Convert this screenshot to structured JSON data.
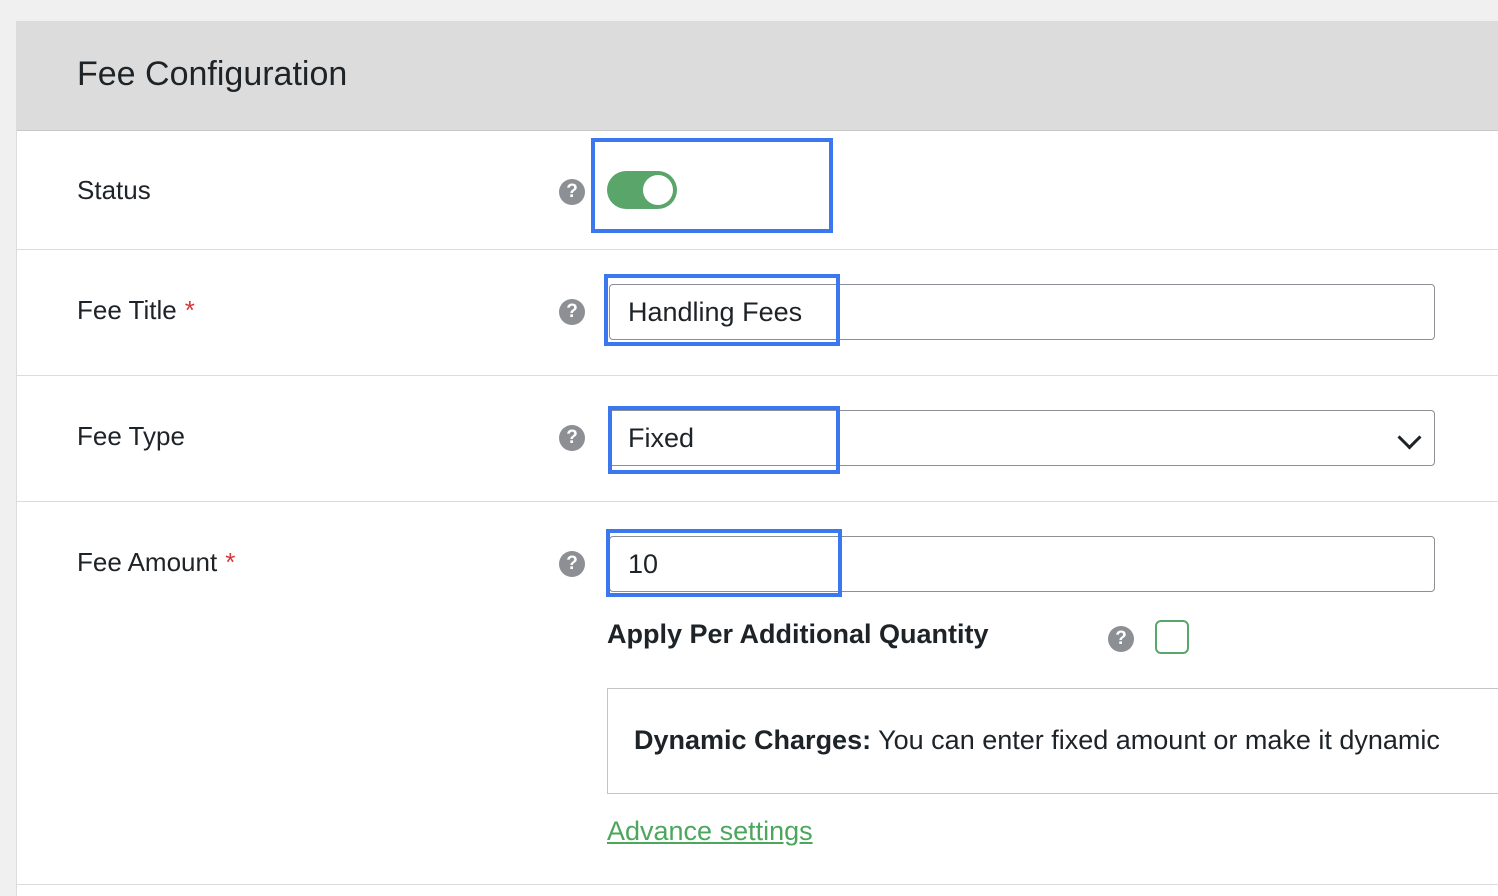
{
  "panel": {
    "title": "Fee Configuration"
  },
  "rows": {
    "status": {
      "label": "Status",
      "help_icon": "question-circle-icon",
      "toggle_on": true
    },
    "fee_title": {
      "label": "Fee Title",
      "required_mark": "*",
      "help_icon": "question-circle-icon",
      "value": "Handling Fees"
    },
    "fee_type": {
      "label": "Fee Type",
      "help_icon": "question-circle-icon",
      "selected": "Fixed",
      "dropdown_icon": "chevron-down-icon"
    },
    "fee_amount": {
      "label": "Fee Amount",
      "required_mark": "*",
      "help_icon": "question-circle-icon",
      "value": "10",
      "qty_label": "Apply Per Additional Quantity",
      "qty_checked": false,
      "notice_bold": "Dynamic Charges:",
      "notice_text": " You can enter fixed amount or make it dynamic",
      "advance_link": "Advance settings"
    }
  },
  "help_glyph": "?",
  "colors": {
    "accent_green": "#5aa56a",
    "link_green": "#4ca65c",
    "highlight_blue": "#3b78f0",
    "required_red": "#d63638",
    "header_bg": "#dcdcdc"
  }
}
